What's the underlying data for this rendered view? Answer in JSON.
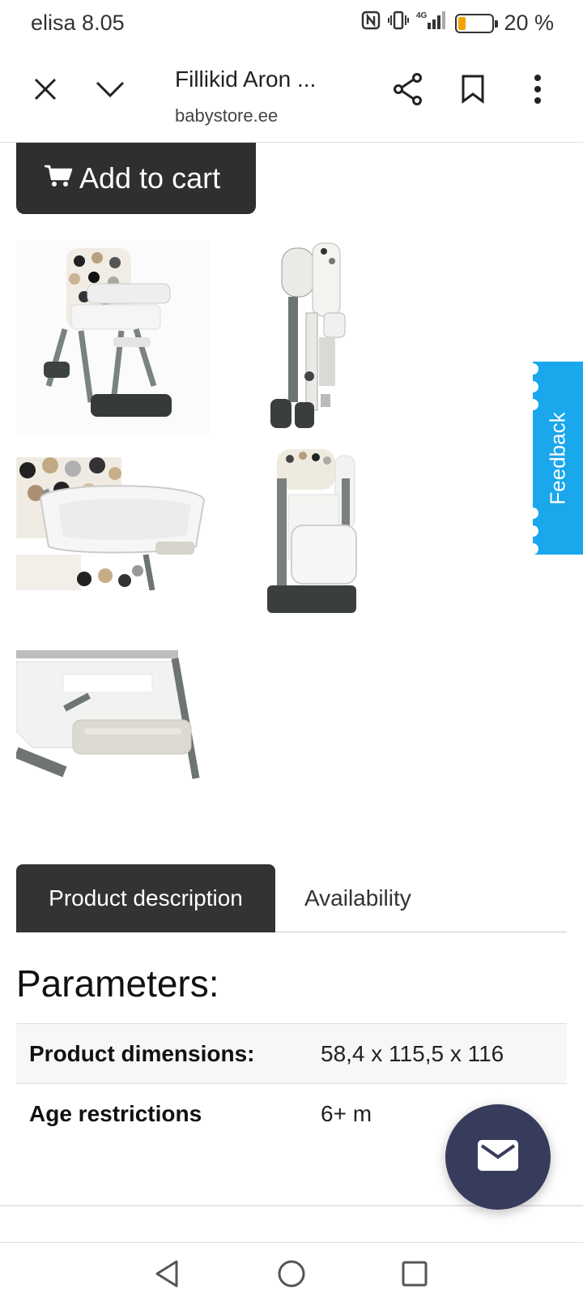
{
  "status_bar": {
    "carrier": "elisa",
    "time": "8.05",
    "network": "4G",
    "battery_percent": "20 %",
    "battery_level": 0.2
  },
  "browser": {
    "page_title": "Fillikid Aron ...",
    "domain": "babystore.ee",
    "icons": [
      "close-icon",
      "chevron-down-icon",
      "share-icon",
      "bookmark-icon",
      "more-vert-icon"
    ]
  },
  "product": {
    "add_to_cart_label": "Add to cart",
    "image_count": 5
  },
  "tabs": [
    {
      "label": "Product description",
      "active": true
    },
    {
      "label": "Availability",
      "active": false
    }
  ],
  "parameters": {
    "title": "Parameters:",
    "rows": [
      {
        "key": "Product dimensions:",
        "value": "58,4 x 115,5 x 116"
      },
      {
        "key": "Age restrictions",
        "value": "6+ m"
      }
    ]
  },
  "feedback": {
    "label": "Feedback",
    "color": "#1aa7ec"
  },
  "chat": {
    "icon": "mail-icon",
    "color": "#383c5c"
  },
  "navbar": {
    "icons": [
      "back-icon",
      "home-icon",
      "recents-icon"
    ]
  }
}
